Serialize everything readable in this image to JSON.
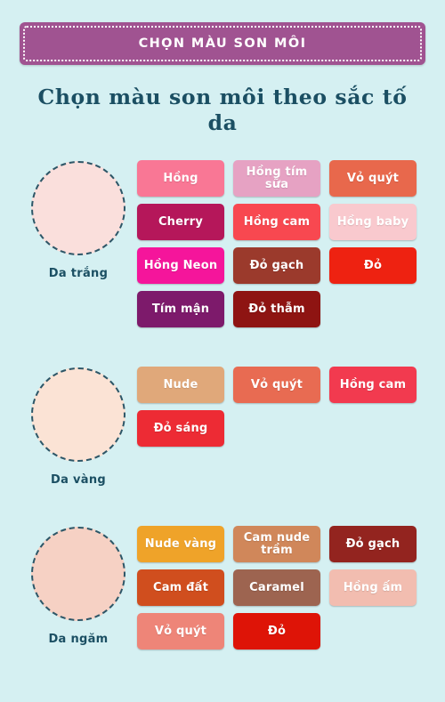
{
  "banner": {
    "title": "CHỌN MÀU SON MÔI",
    "background_color": "#a05391",
    "border_style": "dotted-white"
  },
  "page": {
    "background_color": "#d5f0f2",
    "heading": "Chọn màu son môi theo sắc tố da",
    "heading_color": "#1b4f63"
  },
  "sections": [
    {
      "skin_label": "Da trắng",
      "skin_color": "#fadfdc",
      "swatches": [
        {
          "label": "Hồng",
          "color": "#f97795",
          "text_color": "#ffffff"
        },
        {
          "label": "Hồng tím sữa",
          "color": "#e6a2c3",
          "text_color": "#ffffff"
        },
        {
          "label": "Vỏ quýt",
          "color": "#e8684c",
          "text_color": "#ffffff"
        },
        {
          "label": "Cherry",
          "color": "#b5175a",
          "text_color": "#ffffff"
        },
        {
          "label": "Hồng cam",
          "color": "#f84850",
          "text_color": "#ffffff"
        },
        {
          "label": "Hồng baby",
          "color": "#f9c9ce",
          "text_color": "#ffffff"
        },
        {
          "label": "Hồng Neon",
          "color": "#f5159b",
          "text_color": "#ffffff"
        },
        {
          "label": "Đỏ gạch",
          "color": "#9b3a2c",
          "text_color": "#ffffff"
        },
        {
          "label": "Đỏ",
          "color": "#ee2211",
          "text_color": "#ffffff"
        },
        {
          "label": "Tím mận",
          "color": "#7d1a6b",
          "text_color": "#ffffff"
        },
        {
          "label": "Đỏ thẫm",
          "color": "#8e1412",
          "text_color": "#ffffff"
        }
      ]
    },
    {
      "skin_label": "Da vàng",
      "skin_color": "#fbe3d5",
      "swatches": [
        {
          "label": "Nude",
          "color": "#e0a87a",
          "text_color": "#ffffff"
        },
        {
          "label": "Vỏ quýt",
          "color": "#e86b52",
          "text_color": "#ffffff"
        },
        {
          "label": "Hồng cam",
          "color": "#f23a4f",
          "text_color": "#ffffff"
        },
        {
          "label": "Đỏ sáng",
          "color": "#ed2b34",
          "text_color": "#ffffff"
        }
      ]
    },
    {
      "skin_label": "Da ngăm",
      "skin_color": "#f6d1c4",
      "swatches": [
        {
          "label": "Nude vàng",
          "color": "#efa329",
          "text_color": "#ffffff"
        },
        {
          "label": "Cam nude trầm",
          "color": "#d0875a",
          "text_color": "#ffffff"
        },
        {
          "label": "Đỏ gạch",
          "color": "#93241f",
          "text_color": "#ffffff"
        },
        {
          "label": "Cam đất",
          "color": "#d04e1e",
          "text_color": "#ffffff"
        },
        {
          "label": "Caramel",
          "color": "#9d6450",
          "text_color": "#ffffff"
        },
        {
          "label": "Hồng ấm",
          "color": "#f2bdb0",
          "text_color": "#ffffff"
        },
        {
          "label": "Vỏ quýt",
          "color": "#ee8578",
          "text_color": "#ffffff"
        },
        {
          "label": "Đỏ",
          "color": "#de1407",
          "text_color": "#ffffff"
        }
      ]
    }
  ]
}
